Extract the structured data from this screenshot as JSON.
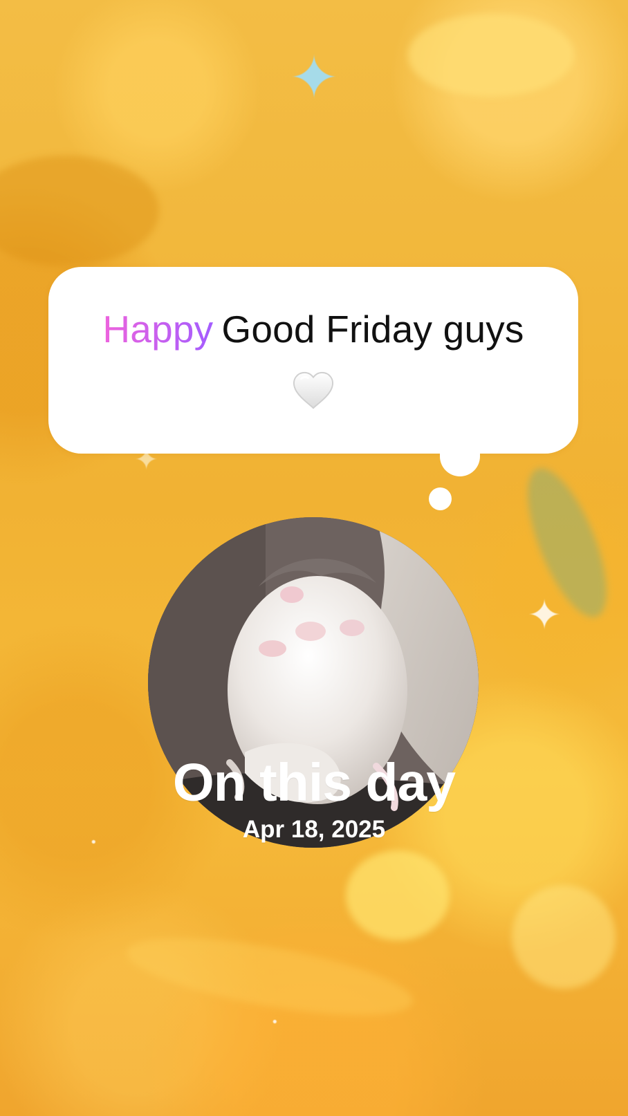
{
  "bubble": {
    "highlight": "Happy",
    "text": "Good Friday guys",
    "emoji": "white-heart"
  },
  "memory": {
    "title": "On this day",
    "date": "Apr 18, 2025"
  }
}
